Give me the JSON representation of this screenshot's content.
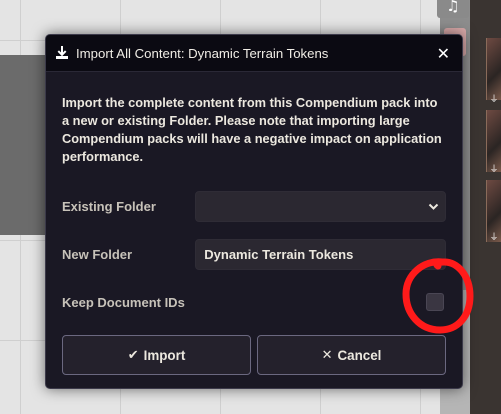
{
  "dialog": {
    "title": "Import All Content: Dynamic Terrain Tokens",
    "close_glyph": "✕",
    "description": "Import the complete content from this Compendium pack into a new or existing Folder. Please note that importing large Compendium packs will have a negative impact on application performance.",
    "fields": {
      "existing_folder": {
        "label": "Existing Folder",
        "value": ""
      },
      "new_folder": {
        "label": "New Folder",
        "value": "Dynamic Terrain Tokens"
      },
      "keep_ids": {
        "label": "Keep Document IDs",
        "checked": false
      }
    },
    "buttons": {
      "import": {
        "glyph": "✔",
        "label": "Import"
      },
      "cancel": {
        "glyph": "✕",
        "label": "Cancel"
      }
    }
  },
  "background": {
    "music_glyph": "♫",
    "plug_glyph": "⏚"
  },
  "colors": {
    "dialog_bg": "#1a1824",
    "header_bg": "#0b0a12",
    "annotation_red": "#ff1a1a"
  }
}
